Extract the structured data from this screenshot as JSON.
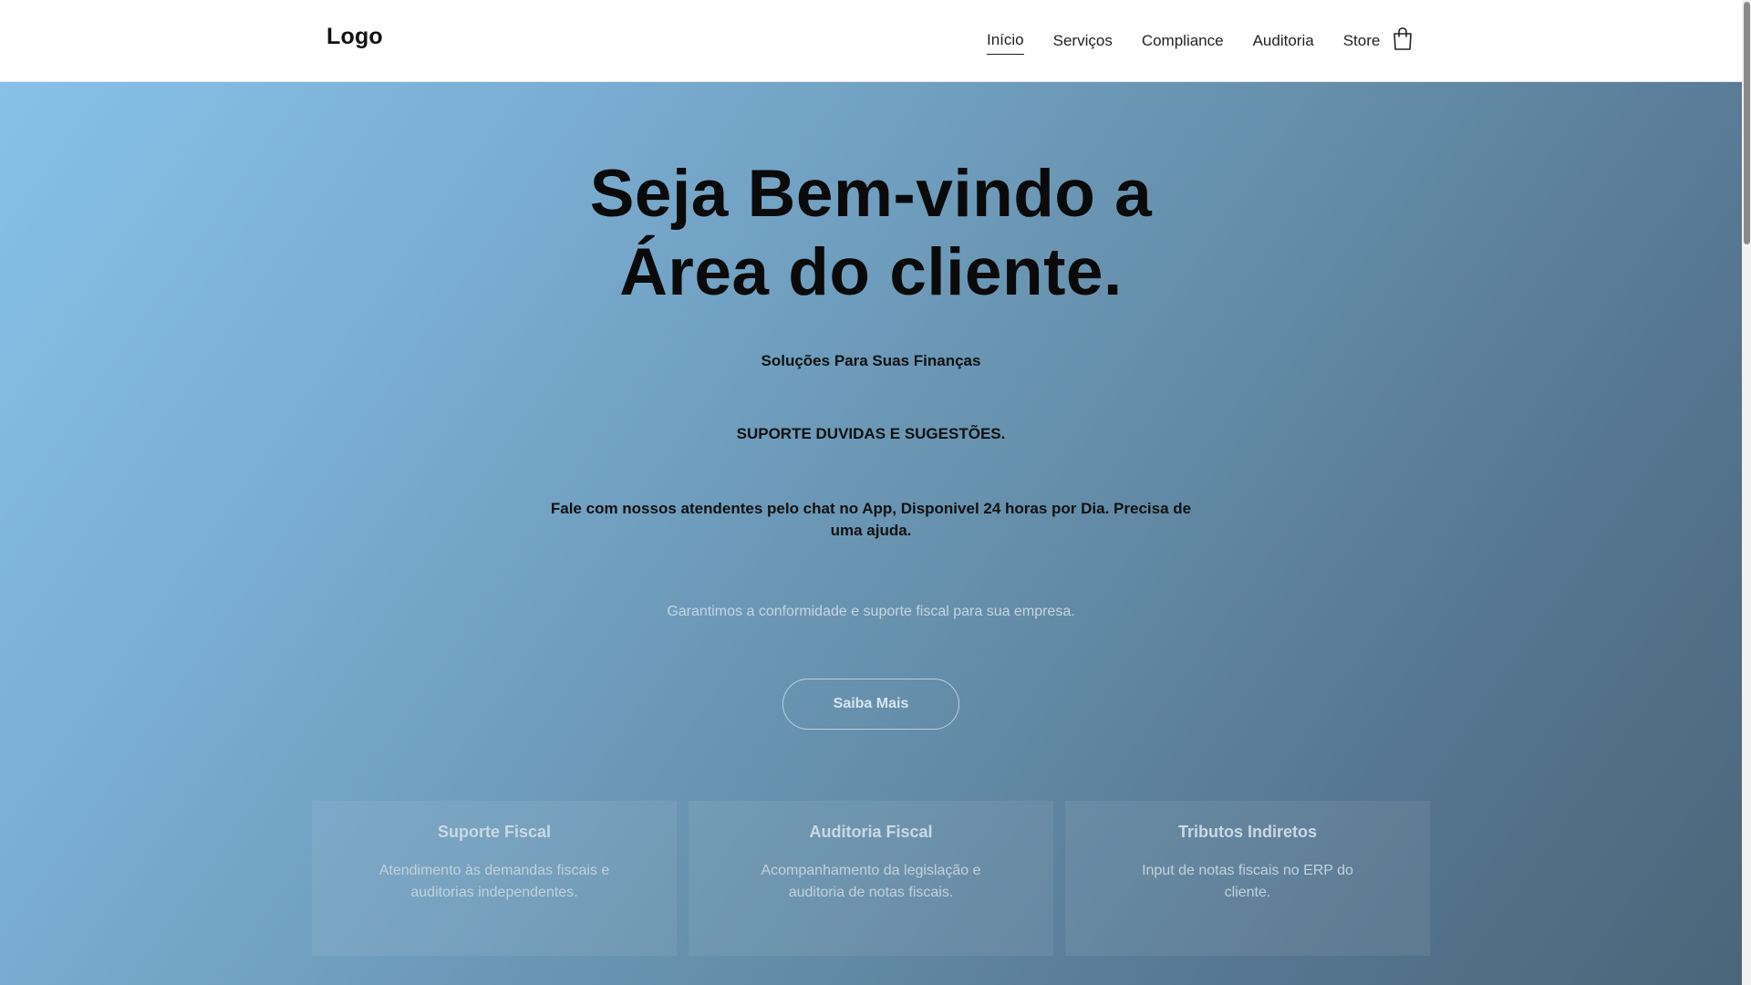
{
  "header": {
    "logo": "Logo",
    "nav": [
      {
        "label": "Início",
        "active": true
      },
      {
        "label": "Serviços",
        "active": false
      },
      {
        "label": "Compliance",
        "active": false
      },
      {
        "label": "Auditoria",
        "active": false
      },
      {
        "label": "Store",
        "active": false
      }
    ],
    "cart_icon": "shopping-bag-icon"
  },
  "hero": {
    "title_line1": "Seja Bem-vindo a",
    "title_line2": "Área do cliente.",
    "subtitle1": "Soluções Para Suas Finanças",
    "subtitle2": "SUPORTE DUVIDAS E SUGESTÕES.",
    "subtitle3": "Fale com nossos atendentes pelo chat no App, Disponivel 24 horas por Dia. Precisa de uma ajuda.",
    "tagline": "Garantimos a conformidade e suporte fiscal para sua empresa.",
    "cta_label": "Saiba Mais"
  },
  "cards": [
    {
      "title": "Suporte Fiscal",
      "text": "Atendimento às demandas fiscais e auditorias independentes."
    },
    {
      "title": "Auditoria Fiscal",
      "text": "Acompanhamento da legislação e auditoria de notas fiscais."
    },
    {
      "title": "Tributos Indiretos",
      "text": "Input de notas fiscais no ERP do cliente."
    }
  ],
  "colors": {
    "gradient_start": "#86c1e8",
    "gradient_end": "#4a6679",
    "text_dark": "#0a0a0a"
  }
}
